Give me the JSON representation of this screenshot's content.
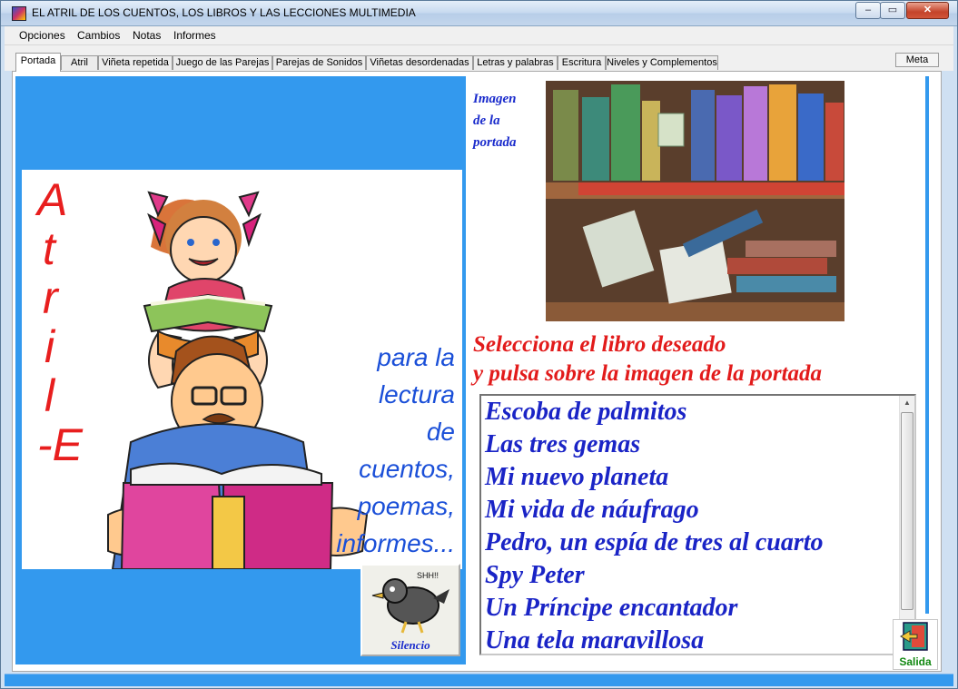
{
  "window": {
    "title": "EL ATRIL DE LOS CUENTOS, LOS LIBROS Y LAS LECCIONES MULTIMEDIA",
    "minimize": "‒",
    "maximize": "▭",
    "close": "✕"
  },
  "menu": [
    "Opciones",
    "Cambios",
    "Notas",
    "Informes"
  ],
  "tabs": [
    "Portada",
    "Atril",
    "Viñeta repetida",
    "Juego de las Parejas",
    "Parejas de Sonidos",
    "Viñetas desordenadas",
    "Letras y palabras",
    "Escritura",
    "Niveles y Complementos"
  ],
  "active_tab": "Portada",
  "meta_button": "Meta",
  "cover_page": {
    "big_letters": [
      "A",
      "t",
      "r",
      "i",
      "l",
      "-E"
    ],
    "tagline": [
      "para la",
      "lectura",
      "de",
      "cuentos,",
      "poemas,",
      "informes..."
    ],
    "silencio_label": "Silencio",
    "silencio_sign": "SHH!!"
  },
  "preview": {
    "label_lines": [
      "Imagen",
      "de la",
      "portada"
    ]
  },
  "instruction": {
    "line1": "Selecciona el libro deseado",
    "line2": "y pulsa sobre la imagen de la portada"
  },
  "books": [
    "Escoba de palmitos",
    "Las tres gemas",
    "Mi nuevo planeta",
    "Mi vida de náufrago",
    "Pedro, un espía de tres al cuarto",
    "Spy Peter",
    "Un Príncipe encantador",
    "Una tela maravillosa"
  ],
  "salida_label": "Salida",
  "colors": {
    "accent_blue": "#3399ee",
    "title_red": "#e81e1e",
    "list_blue": "#1a24c6",
    "salida_green": "#118811"
  }
}
